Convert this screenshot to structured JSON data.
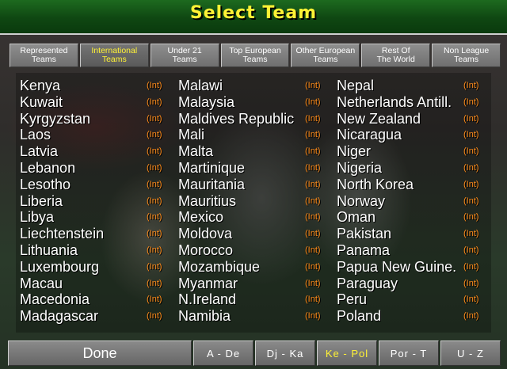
{
  "title": "Select Team",
  "tabs": [
    {
      "label": "Represented\nTeams",
      "active": false
    },
    {
      "label": "International\nTeams",
      "active": true
    },
    {
      "label": "Under 21\nTeams",
      "active": false
    },
    {
      "label": "Top European\nTeams",
      "active": false
    },
    {
      "label": "Other European\nTeams",
      "active": false
    },
    {
      "label": "Rest Of\nThe World",
      "active": false
    },
    {
      "label": "Non League\nTeams",
      "active": false
    }
  ],
  "tag_label": "(Int)",
  "columns": [
    [
      "Kenya",
      "Kuwait",
      "Kyrgyzstan",
      "Laos",
      "Latvia",
      "Lebanon",
      "Lesotho",
      "Liberia",
      "Libya",
      "Liechtenstein",
      "Lithuania",
      "Luxembourg",
      "Macau",
      "Macedonia",
      "Madagascar"
    ],
    [
      "Malawi",
      "Malaysia",
      "Maldives Republic",
      "Mali",
      "Malta",
      "Martinique",
      "Mauritania",
      "Mauritius",
      "Mexico",
      "Moldova",
      "Morocco",
      "Mozambique",
      "Myanmar",
      "N.Ireland",
      "Namibia"
    ],
    [
      "Nepal",
      "Netherlands Antill.",
      "New Zealand",
      "Nicaragua",
      "Niger",
      "Nigeria",
      "North Korea",
      "Norway",
      "Oman",
      "Pakistan",
      "Panama",
      "Papua New Guine.",
      "Paraguay",
      "Peru",
      "Poland"
    ]
  ],
  "bottom": {
    "done_label": "Done",
    "ranges": [
      {
        "label": "A - De",
        "active": false
      },
      {
        "label": "Dj - Ka",
        "active": false
      },
      {
        "label": "Ke - Pol",
        "active": true
      },
      {
        "label": "Por - T",
        "active": false
      },
      {
        "label": "U - Z",
        "active": false
      }
    ]
  },
  "colors": {
    "title": "#fff235",
    "tag": "#ff8c1a",
    "active_tab": "#fff235"
  }
}
